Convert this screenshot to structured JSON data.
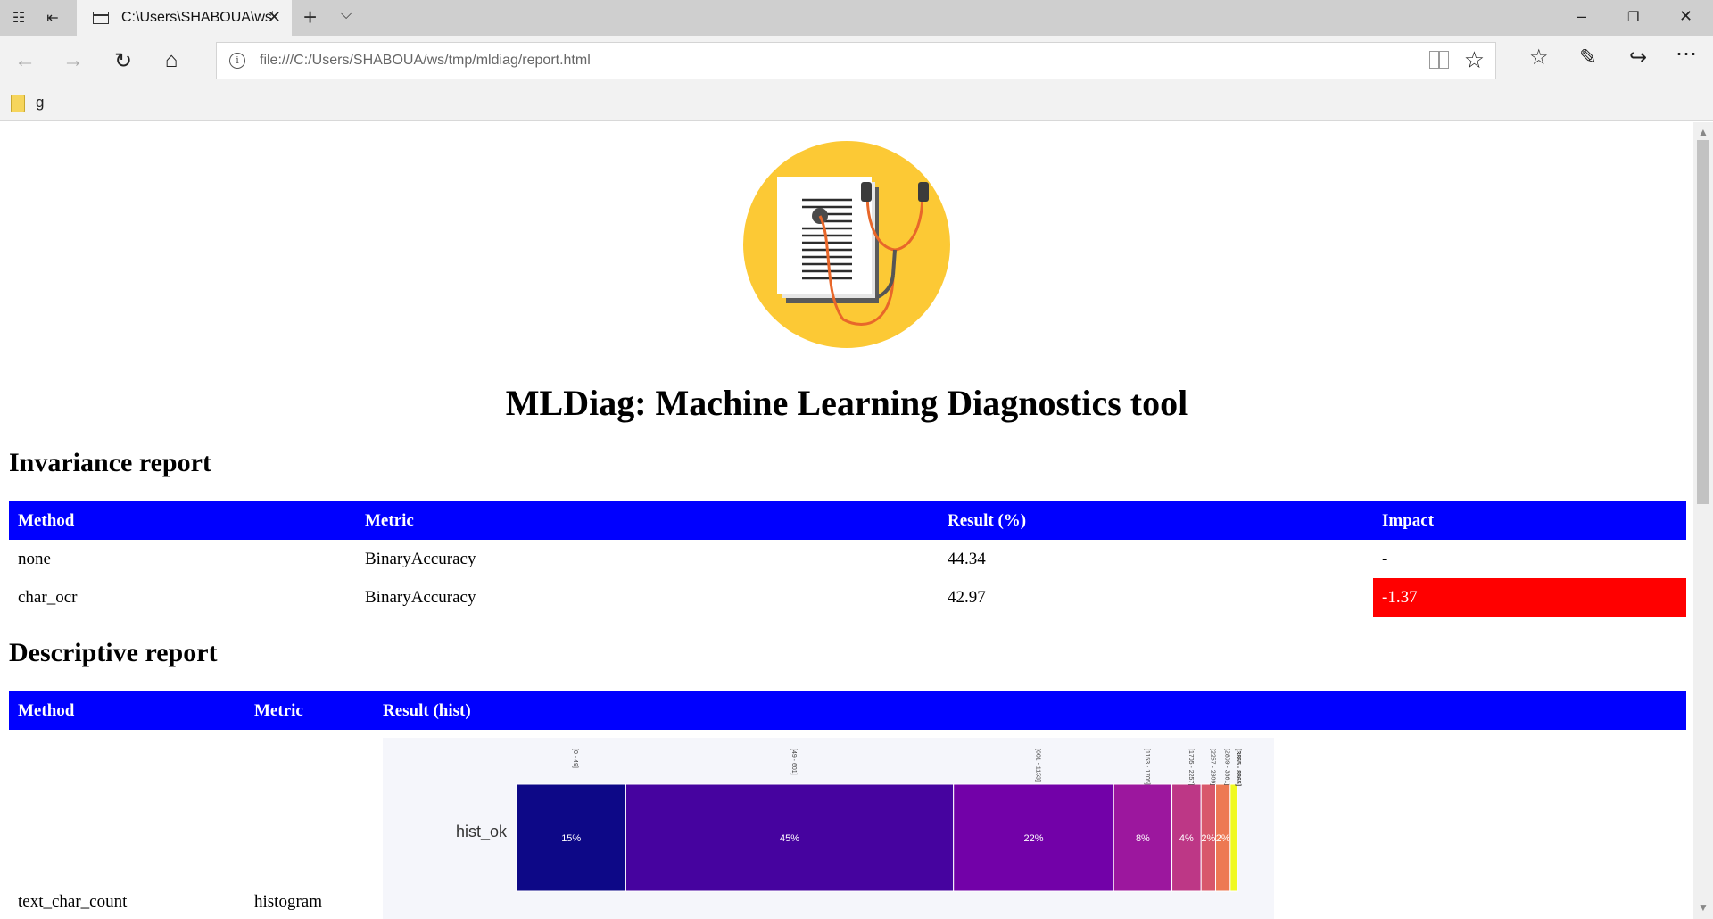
{
  "browser": {
    "tab_title": "C:\\Users\\SHABOUA\\ws\\",
    "address": "file:///C:/Users/SHABOUA/ws/tmp/mldiag/report.html",
    "favorites": [
      {
        "label": "g"
      }
    ]
  },
  "page": {
    "title": "MLDiag: Machine Learning Diagnostics tool",
    "invariance": {
      "heading": "Invariance report",
      "columns": [
        "Method",
        "Metric",
        "Result (%)",
        "Impact"
      ],
      "rows": [
        {
          "method": "none",
          "metric": "BinaryAccuracy",
          "result": "44.34",
          "impact": "-"
        },
        {
          "method": "char_ocr",
          "metric": "BinaryAccuracy",
          "result": "42.97",
          "impact": "-1.37"
        }
      ],
      "negative_color": "#ff0000"
    },
    "descriptive": {
      "heading": "Descriptive report",
      "columns": [
        "Method",
        "Metric",
        "Result (hist)"
      ],
      "rows": [
        {
          "method": "text_char_count",
          "metric": "histogram"
        }
      ]
    },
    "header_color": "#0000ff"
  },
  "chart_data": {
    "type": "bar",
    "orientation": "horizontal-stacked",
    "row_label": "hist_ok",
    "categories": [
      "[0 - 49]",
      "[49 - 601]",
      "[601 - 1153]",
      "[1153 - 1705]",
      "[1705 - 2257]",
      "[2257 - 2809]",
      "[2809 - 3361]",
      "[3865 - 8865]"
    ],
    "values": [
      15,
      45,
      22,
      8,
      4,
      2,
      2,
      1
    ],
    "labels": [
      "15%",
      "45%",
      "22%",
      "8%",
      "4%",
      "2%",
      "2%",
      ""
    ],
    "colors": [
      "#0d0887",
      "#46039f",
      "#7201a8",
      "#9c179e",
      "#bd3786",
      "#d8576b",
      "#ed7953",
      "#f0f921"
    ]
  }
}
